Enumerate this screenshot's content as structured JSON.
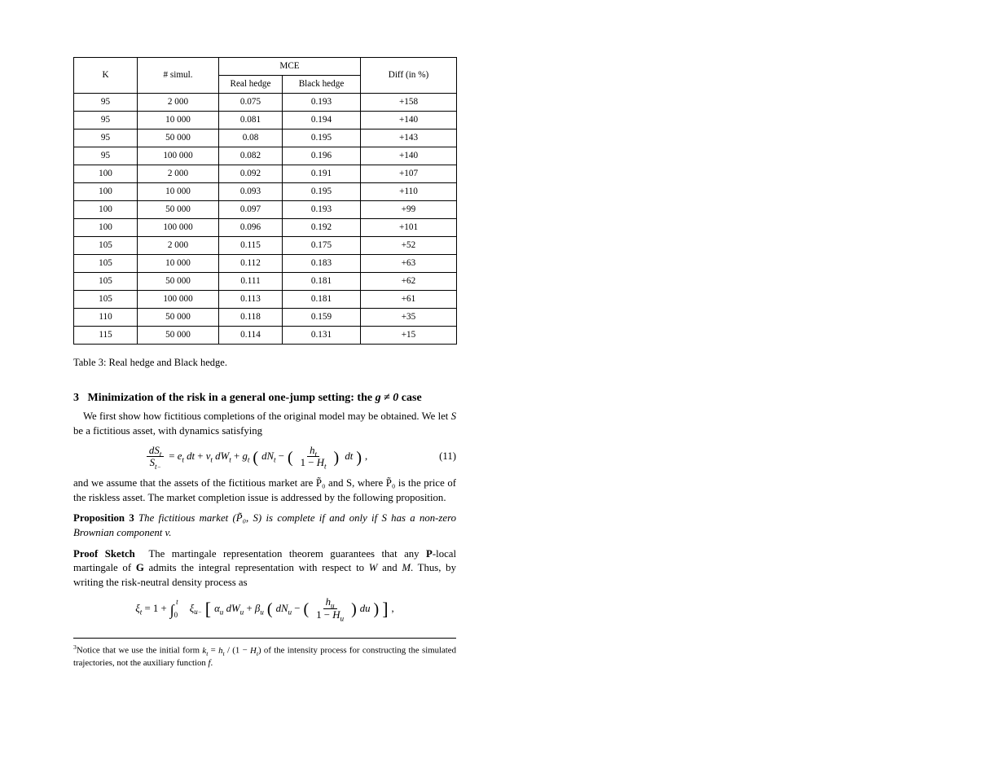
{
  "chart_data": {
    "type": "table",
    "title": "Table 3: Real hedge and Black hedge.",
    "columns": [
      "K",
      "# simul.",
      "Real hedge",
      "Black hedge",
      "Diff (in %)"
    ],
    "column_group": {
      "label": "MCE",
      "span_cols": [
        "Real hedge",
        "Black hedge"
      ]
    },
    "rows": [
      {
        "K": 95,
        "sim": "2 000",
        "real": 0.075,
        "black": 0.193,
        "diff": "+158"
      },
      {
        "K": 95,
        "sim": "10 000",
        "real": 0.081,
        "black": 0.194,
        "diff": "+140"
      },
      {
        "K": 95,
        "sim": "50 000",
        "real": 0.08,
        "black": 0.195,
        "diff": "+143"
      },
      {
        "K": 95,
        "sim": "100 000",
        "real": 0.082,
        "black": 0.196,
        "diff": "+140"
      },
      {
        "K": 100,
        "sim": "2 000",
        "real": 0.092,
        "black": 0.191,
        "diff": "+107"
      },
      {
        "K": 100,
        "sim": "10 000",
        "real": 0.093,
        "black": 0.195,
        "diff": "+110"
      },
      {
        "K": 100,
        "sim": "50 000",
        "real": 0.097,
        "black": 0.193,
        "diff": "+99"
      },
      {
        "K": 100,
        "sim": "100 000",
        "real": 0.096,
        "black": 0.192,
        "diff": "+101"
      },
      {
        "K": 105,
        "sim": "2 000",
        "real": 0.115,
        "black": 0.175,
        "diff": "+52"
      },
      {
        "K": 105,
        "sim": "10 000",
        "real": 0.112,
        "black": 0.183,
        "diff": "+63"
      },
      {
        "K": 105,
        "sim": "50 000",
        "real": 0.111,
        "black": 0.181,
        "diff": "+62"
      },
      {
        "K": 105,
        "sim": "100 000",
        "real": 0.113,
        "black": 0.181,
        "diff": "+61"
      },
      {
        "K": 110,
        "sim": "50 000",
        "real": 0.118,
        "black": 0.159,
        "diff": "+35"
      },
      {
        "K": 115,
        "sim": "50 000",
        "real": 0.114,
        "black": 0.131,
        "diff": "+15"
      }
    ]
  },
  "caption": "Table 3: Real hedge and Black hedge.",
  "section3_num": "3",
  "section3_title2": "case",
  "para1_a": "We first show how fictitious completions of the original model may be obtained. We let ",
  "para1_b": " be a fictitious asset, with dynamics satisfying",
  "eq11_label": "(11)",
  "para2": "and we assume that the assets of the fictitious market are P̃₀ and S, where P̃₀ is the price of the riskless asset. The market completion issue is addressed by the following proposition.",
  "prop_label": "Proposition 3",
  "prop_body": " The fictitious market (P̃₀, S) is complete if and only if S has a non-zero Brownian component v.",
  "footnote_marker": "3",
  "footnote_a": "Notice that we use the initial form ",
  "footnote_b": " of the intensity process for constructing the simulated trajectories, not the auxiliary function "
}
